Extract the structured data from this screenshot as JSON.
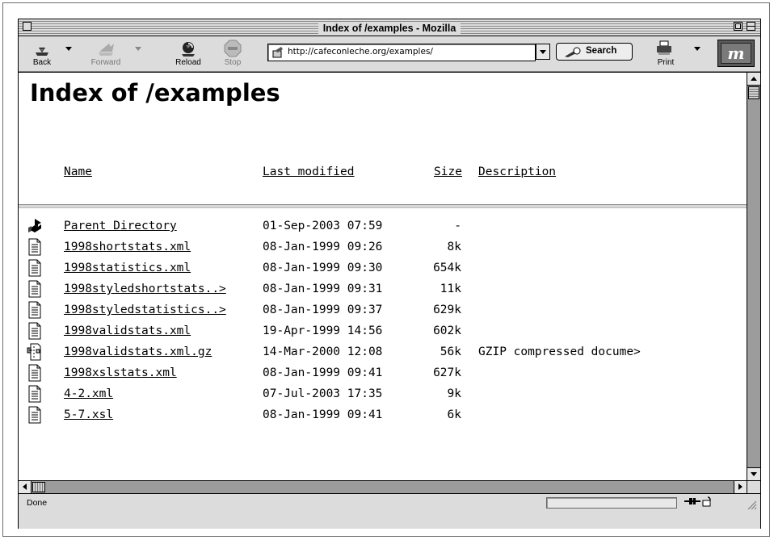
{
  "window": {
    "title": "Index of /examples - Mozilla"
  },
  "toolbar": {
    "back_label": "Back",
    "forward_label": "Forward",
    "reload_label": "Reload",
    "stop_label": "Stop",
    "url": "http://cafeconleche.org/examples/",
    "search_label": "Search",
    "print_label": "Print",
    "logo_letter": "m"
  },
  "page": {
    "title": "Index of /examples",
    "columns": {
      "name": "Name",
      "modified": "Last modified",
      "size": "Size",
      "description": "Description"
    },
    "rows": [
      {
        "icon": "parent-dir-icon",
        "name": "Parent Directory",
        "modified": "01-Sep-2003 07:59",
        "size": "-",
        "description": ""
      },
      {
        "icon": "text-file-icon",
        "name": "1998shortstats.xml",
        "modified": "08-Jan-1999 09:26",
        "size": "8k",
        "description": ""
      },
      {
        "icon": "text-file-icon",
        "name": "1998statistics.xml",
        "modified": "08-Jan-1999 09:30",
        "size": "654k",
        "description": ""
      },
      {
        "icon": "text-file-icon",
        "name": "1998styledshortstats..>",
        "modified": "08-Jan-1999 09:31",
        "size": "11k",
        "description": ""
      },
      {
        "icon": "text-file-icon",
        "name": "1998styledstatistics..>",
        "modified": "08-Jan-1999 09:37",
        "size": "629k",
        "description": ""
      },
      {
        "icon": "text-file-icon",
        "name": "1998validstats.xml",
        "modified": "19-Apr-1999 14:56",
        "size": "602k",
        "description": ""
      },
      {
        "icon": "compressed-file-icon",
        "name": "1998validstats.xml.gz",
        "modified": "14-Mar-2000 12:08",
        "size": "56k",
        "description": "GZIP compressed docume>"
      },
      {
        "icon": "text-file-icon",
        "name": "1998xslstats.xml",
        "modified": "08-Jan-1999 09:41",
        "size": "627k",
        "description": ""
      },
      {
        "icon": "text-file-icon",
        "name": "4-2.xml",
        "modified": "07-Jul-2003 17:35",
        "size": "9k",
        "description": ""
      },
      {
        "icon": "text-file-icon",
        "name": "5-7.xsl",
        "modified": "08-Jan-1999 09:41",
        "size": "6k",
        "description": ""
      }
    ]
  },
  "status": {
    "text": "Done"
  }
}
